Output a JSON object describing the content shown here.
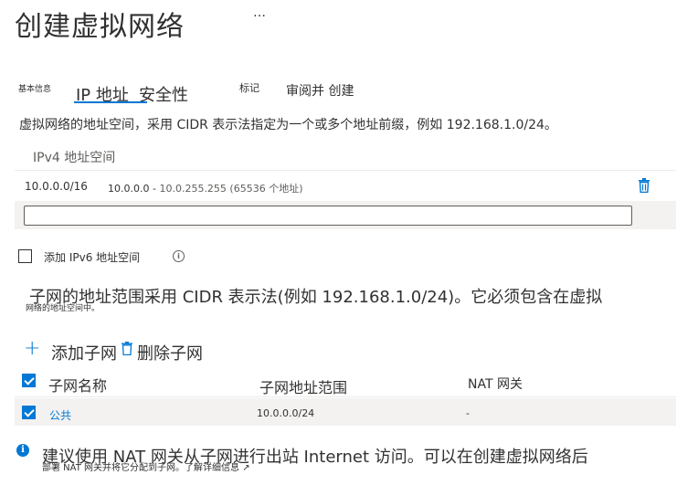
{
  "page": {
    "title": "创建虚拟网络",
    "more": "…"
  },
  "tabs": [
    {
      "label": "基本信息"
    },
    {
      "label": "IP 地址"
    },
    {
      "label": "安全性"
    },
    {
      "label": "标记"
    },
    {
      "label": "审阅并 创建"
    }
  ],
  "address_space": {
    "description": "虚拟网络的地址空间，采用 CIDR 表示法指定为一个或多个地址前缀，例如 192.168.1.0/24。",
    "header": "IPv4 地址空间",
    "rows": [
      {
        "cidr": "10.0.0.0/16",
        "range_start": "10.0.0.0 -",
        "range_rest": "10.0.255.255 (65536 个地址)"
      }
    ],
    "new_value": ""
  },
  "ipv6": {
    "label": "添加 IPv6 地址空间",
    "checked": false,
    "info_glyph": "i"
  },
  "subnets": {
    "description": "子网的地址范围采用 CIDR 表示法(例如 192.168.1.0/24)。它必须包含在虚拟",
    "description_overflow": "网络的地址空间中。",
    "add_label": "添加子网",
    "add_glyph": "+",
    "delete_label": "删除子网",
    "columns": [
      "子网名称",
      "子网地址范围",
      "NAT 网关"
    ],
    "rows": [
      {
        "name": "公共",
        "range": "10.0.0.0/24",
        "nat": "-",
        "selected": true
      }
    ]
  },
  "note": {
    "glyph": "i",
    "line1": "建议使用 NAT 网关从子网进行出站 Internet 访问。可以在创建虚拟网络后",
    "line2": "部署 NAT 网关并将它分配到子网。了解详细信息 ↗"
  },
  "colors": {
    "accent": "#0078d4",
    "band": "#f3f2f1",
    "text": "#323130"
  },
  "icons": [
    "ellipsis-icon",
    "trash-icon",
    "info-icon",
    "plus-icon",
    "checkbox-icon"
  ]
}
